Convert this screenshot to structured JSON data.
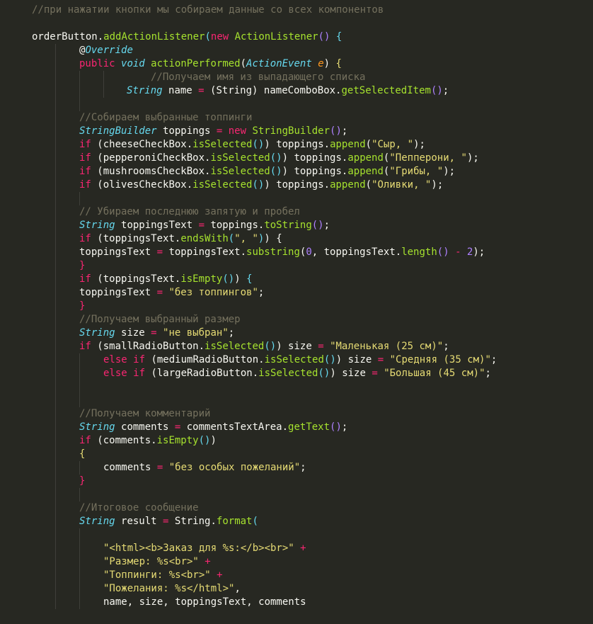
{
  "colors": {
    "background": "#272822",
    "comment": "#75715e",
    "keyword": "#f92672",
    "type": "#66d9ef",
    "function": "#a6e22e",
    "string": "#e6db74",
    "number": "#ae81ff",
    "parameter": "#fd971f",
    "default": "#f8f8f2"
  },
  "lines": [
    [
      [
        "comment",
        "//при нажатии кнопки мы собираем данные со всех компонентов"
      ]
    ],
    [],
    [
      [
        "default",
        "orderButton."
      ],
      [
        "func",
        "addActionListener"
      ],
      [
        "paren1",
        "("
      ],
      [
        "keyword",
        "new "
      ],
      [
        "func",
        "ActionListener"
      ],
      [
        "paren2",
        "()"
      ],
      [
        "default",
        " "
      ],
      [
        "paren1",
        "{"
      ]
    ],
    [
      [
        "ann",
        "@"
      ],
      [
        "annname",
        "Override"
      ]
    ],
    [
      [
        "keyword",
        "public "
      ],
      [
        "type",
        "void "
      ],
      [
        "func",
        "actionPerformed"
      ],
      [
        "paren3",
        "("
      ],
      [
        "type",
        "ActionEvent "
      ],
      [
        "param",
        "e"
      ],
      [
        "paren3",
        ")"
      ],
      [
        "default",
        " "
      ],
      [
        "bracey",
        "{"
      ]
    ],
    [
      [
        "comment",
        "//Получаем имя из выпадающего списка"
      ]
    ],
    [
      [
        "type",
        "String "
      ],
      [
        "default",
        "name "
      ],
      [
        "op",
        "= "
      ],
      [
        "paren3",
        "("
      ],
      [
        "default",
        "String"
      ],
      [
        "paren3",
        ")"
      ],
      [
        "default",
        " nameComboBox."
      ],
      [
        "func",
        "getSelectedItem"
      ],
      [
        "paren2",
        "()"
      ],
      [
        "default",
        ";"
      ]
    ],
    [],
    [
      [
        "comment",
        "//Собираем выбранные топпинги"
      ]
    ],
    [
      [
        "type",
        "StringBuilder "
      ],
      [
        "default",
        "toppings "
      ],
      [
        "op",
        "= "
      ],
      [
        "keyword",
        "new "
      ],
      [
        "func",
        "StringBuilder"
      ],
      [
        "paren2",
        "()"
      ],
      [
        "default",
        ";"
      ]
    ],
    [
      [
        "keyword",
        "if "
      ],
      [
        "paren3",
        "("
      ],
      [
        "default",
        "cheeseCheckBox."
      ],
      [
        "func",
        "isSelected"
      ],
      [
        "paren1",
        "()"
      ],
      [
        "paren3",
        ")"
      ],
      [
        "default",
        " toppings."
      ],
      [
        "func",
        "append"
      ],
      [
        "paren3",
        "("
      ],
      [
        "string",
        "\"Сыр, \""
      ],
      [
        "paren3",
        ")"
      ],
      [
        "default",
        ";"
      ]
    ],
    [
      [
        "keyword",
        "if "
      ],
      [
        "paren3",
        "("
      ],
      [
        "default",
        "pepperoniCheckBox."
      ],
      [
        "func",
        "isSelected"
      ],
      [
        "paren1",
        "()"
      ],
      [
        "paren3",
        ")"
      ],
      [
        "default",
        " toppings."
      ],
      [
        "func",
        "append"
      ],
      [
        "paren3",
        "("
      ],
      [
        "string",
        "\"Пепперони, \""
      ],
      [
        "paren3",
        ")"
      ],
      [
        "default",
        ";"
      ]
    ],
    [
      [
        "keyword",
        "if "
      ],
      [
        "paren3",
        "("
      ],
      [
        "default",
        "mushroomsCheckBox."
      ],
      [
        "func",
        "isSelected"
      ],
      [
        "paren1",
        "()"
      ],
      [
        "paren3",
        ")"
      ],
      [
        "default",
        " toppings."
      ],
      [
        "func",
        "append"
      ],
      [
        "paren3",
        "("
      ],
      [
        "string",
        "\"Грибы, \""
      ],
      [
        "paren3",
        ")"
      ],
      [
        "default",
        ";"
      ]
    ],
    [
      [
        "keyword",
        "if "
      ],
      [
        "paren3",
        "("
      ],
      [
        "default",
        "olivesCheckBox."
      ],
      [
        "func",
        "isSelected"
      ],
      [
        "paren1",
        "()"
      ],
      [
        "paren3",
        ")"
      ],
      [
        "default",
        " toppings."
      ],
      [
        "func",
        "append"
      ],
      [
        "paren3",
        "("
      ],
      [
        "string",
        "\"Оливки, \""
      ],
      [
        "paren3",
        ")"
      ],
      [
        "default",
        ";"
      ]
    ],
    [],
    [
      [
        "comment",
        "// Убираем последнюю запятую и пробел"
      ]
    ],
    [
      [
        "type",
        "String "
      ],
      [
        "default",
        "toppingsText "
      ],
      [
        "op",
        "= "
      ],
      [
        "default",
        "toppings."
      ],
      [
        "func",
        "toString"
      ],
      [
        "paren2",
        "()"
      ],
      [
        "default",
        ";"
      ]
    ],
    [
      [
        "keyword",
        "if "
      ],
      [
        "paren3",
        "("
      ],
      [
        "default",
        "toppingsText."
      ],
      [
        "func",
        "endsWith"
      ],
      [
        "paren1",
        "("
      ],
      [
        "string",
        "\", \""
      ],
      [
        "paren1",
        ")"
      ],
      [
        "paren3",
        ")"
      ],
      [
        "default",
        " "
      ],
      [
        "paren3",
        "{"
      ]
    ],
    [
      [
        "default",
        "toppingsText "
      ],
      [
        "op",
        "= "
      ],
      [
        "default",
        "toppingsText."
      ],
      [
        "func",
        "substring"
      ],
      [
        "paren3",
        "("
      ],
      [
        "number",
        "0"
      ],
      [
        "default",
        ", toppingsText."
      ],
      [
        "func",
        "length"
      ],
      [
        "paren2",
        "()"
      ],
      [
        "default",
        " "
      ],
      [
        "op",
        "- "
      ],
      [
        "number",
        "2"
      ],
      [
        "paren3",
        ")"
      ],
      [
        "default",
        ";"
      ]
    ],
    [
      [
        "keyword",
        "}"
      ]
    ],
    [
      [
        "keyword",
        "if "
      ],
      [
        "paren3",
        "("
      ],
      [
        "default",
        "toppingsText."
      ],
      [
        "func",
        "isEmpty"
      ],
      [
        "paren1",
        "()"
      ],
      [
        "paren3",
        ")"
      ],
      [
        "default",
        " "
      ],
      [
        "paren1",
        "{"
      ]
    ],
    [
      [
        "default",
        "toppingsText "
      ],
      [
        "op",
        "= "
      ],
      [
        "string",
        "\"без топпингов\""
      ],
      [
        "default",
        ";"
      ]
    ],
    [
      [
        "keyword",
        "}"
      ]
    ],
    [
      [
        "comment",
        "//Получаем выбранный размер"
      ]
    ],
    [
      [
        "type",
        "String "
      ],
      [
        "default",
        "size "
      ],
      [
        "op",
        "= "
      ],
      [
        "string",
        "\"не выбран\""
      ],
      [
        "default",
        ";"
      ]
    ],
    [
      [
        "keyword",
        "if "
      ],
      [
        "paren3",
        "("
      ],
      [
        "default",
        "smallRadioButton."
      ],
      [
        "func",
        "isSelected"
      ],
      [
        "paren1",
        "()"
      ],
      [
        "paren3",
        ")"
      ],
      [
        "default",
        " size "
      ],
      [
        "op",
        "= "
      ],
      [
        "string",
        "\"Маленькая (25 см)\""
      ],
      [
        "default",
        ";"
      ]
    ],
    [
      [
        "keyword",
        "else if "
      ],
      [
        "paren3",
        "("
      ],
      [
        "default",
        "mediumRadioButton."
      ],
      [
        "func",
        "isSelected"
      ],
      [
        "paren1",
        "()"
      ],
      [
        "paren3",
        ")"
      ],
      [
        "default",
        " size "
      ],
      [
        "op",
        "= "
      ],
      [
        "string",
        "\"Средняя (35 см)\""
      ],
      [
        "default",
        ";"
      ]
    ],
    [
      [
        "keyword",
        "else if "
      ],
      [
        "paren3",
        "("
      ],
      [
        "default",
        "largeRadioButton."
      ],
      [
        "func",
        "isSelected"
      ],
      [
        "paren1",
        "()"
      ],
      [
        "paren3",
        ")"
      ],
      [
        "default",
        " size "
      ],
      [
        "op",
        "= "
      ],
      [
        "string",
        "\"Большая (45 см)\""
      ],
      [
        "default",
        ";"
      ]
    ],
    [],
    [],
    [
      [
        "comment",
        "//Получаем комментарий"
      ]
    ],
    [
      [
        "type",
        "String "
      ],
      [
        "default",
        "comments "
      ],
      [
        "op",
        "= "
      ],
      [
        "default",
        "commentsTextArea."
      ],
      [
        "func",
        "getText"
      ],
      [
        "paren2",
        "()"
      ],
      [
        "default",
        ";"
      ]
    ],
    [
      [
        "keyword",
        "if "
      ],
      [
        "paren3",
        "("
      ],
      [
        "default",
        "comments."
      ],
      [
        "func",
        "isEmpty"
      ],
      [
        "paren1",
        "()"
      ],
      [
        "paren3",
        ")"
      ]
    ],
    [
      [
        "bracey",
        "{"
      ]
    ],
    [
      [
        "default",
        "comments "
      ],
      [
        "op",
        "= "
      ],
      [
        "string",
        "\"без особых пожеланий\""
      ],
      [
        "default",
        ";"
      ]
    ],
    [
      [
        "keyword",
        "}"
      ]
    ],
    [],
    [
      [
        "comment",
        "//Итоговое сообщение"
      ]
    ],
    [
      [
        "type",
        "String "
      ],
      [
        "default",
        "result "
      ],
      [
        "op",
        "= "
      ],
      [
        "default",
        "String."
      ],
      [
        "func",
        "format"
      ],
      [
        "paren1",
        "("
      ]
    ],
    [],
    [
      [
        "string",
        "\"<html><b>Заказ для %s:</b><br>\""
      ],
      [
        "default",
        " "
      ],
      [
        "op",
        "+"
      ]
    ],
    [
      [
        "string",
        "\"Размер: %s<br>\""
      ],
      [
        "default",
        " "
      ],
      [
        "op",
        "+"
      ]
    ],
    [
      [
        "string",
        "\"Топпинги: %s<br>\""
      ],
      [
        "default",
        " "
      ],
      [
        "op",
        "+"
      ]
    ],
    [
      [
        "string",
        "\"Пожелания: %s</html>\""
      ],
      [
        "default",
        ","
      ]
    ],
    [
      [
        "default",
        "name, size, toppingsText, comments"
      ]
    ]
  ]
}
